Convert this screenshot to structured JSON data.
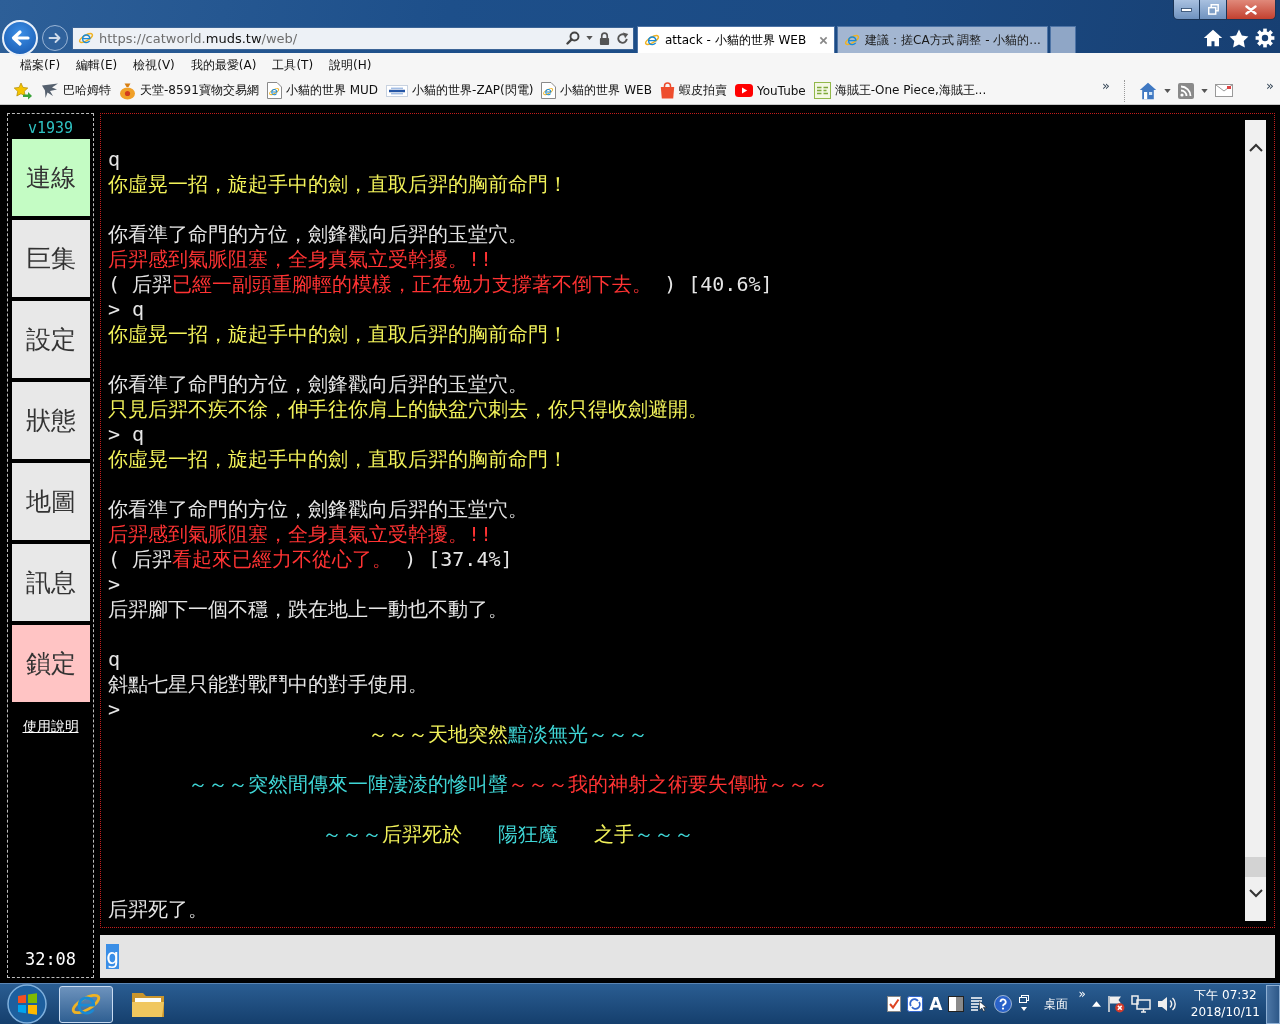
{
  "window": {
    "tabs": [
      {
        "title": "attack - 小貓的世界 WEB",
        "selected": true
      },
      {
        "title": "建議：搓CA方式 調整 - 小貓的...",
        "selected": false
      }
    ],
    "address_bar": {
      "url_parts": [
        {
          "text": "https://catworld.",
          "emphasis": false
        },
        {
          "text": "muds.tw",
          "emphasis": true
        },
        {
          "text": "/web/",
          "emphasis": false
        }
      ]
    },
    "menu_bar": {
      "items": [
        "檔案(F)",
        "編輯(E)",
        "檢視(V)",
        "我的最愛(A)",
        "工具(T)",
        "說明(H)"
      ]
    },
    "favorites_bar": {
      "items": [
        {
          "label": "巴哈姆特",
          "kind": "bird"
        },
        {
          "label": "天堂-8591寶物交易網",
          "kind": "moneybag"
        },
        {
          "label": "小貓的世界 MUD",
          "kind": "page"
        },
        {
          "label": "小貓的世界-ZAP(閃電)",
          "kind": "banner"
        },
        {
          "label": "小貓的世界 WEB",
          "kind": "page"
        },
        {
          "label": "蝦皮拍賣",
          "kind": "bag"
        },
        {
          "label": "YouTube",
          "kind": "video"
        },
        {
          "label": "海賊王-One Piece,海賊王...",
          "kind": "tile"
        }
      ],
      "overflow": "»"
    },
    "command_bar": {
      "overflow": "»"
    }
  },
  "sidebar": {
    "version": "v1939",
    "buttons": [
      {
        "label": "連線",
        "color": "#c4fcc4"
      },
      {
        "label": "巨集",
        "color": "#e8e8e8"
      },
      {
        "label": "設定",
        "color": "#e8e8e8"
      },
      {
        "label": "狀態",
        "color": "#e8e8e8"
      },
      {
        "label": "地圖",
        "color": "#e8e8e8"
      },
      {
        "label": "訊息",
        "color": "#e8e8e8"
      },
      {
        "label": "鎖定",
        "color": "#ffc4c4"
      }
    ],
    "help_link": "使用說明",
    "timer": "32:08"
  },
  "terminal": {
    "lines": [
      {
        "kind": "text",
        "segments": [
          {
            "text": "q",
            "color": "#e6e6e6"
          }
        ]
      },
      {
        "kind": "text",
        "segments": [
          {
            "text": "你虛晃一招，旋起手中的劍，直取后羿的胸前命門！",
            "color": "#f2f25a"
          }
        ]
      },
      {
        "kind": "blank"
      },
      {
        "kind": "text",
        "segments": [
          {
            "text": "你看準了命門的方位，劍鋒戳向后羿的玉堂穴。",
            "color": "#e6e6e6"
          }
        ]
      },
      {
        "kind": "text",
        "segments": [
          {
            "text": "后羿感到氣脈阻塞，全身真氣立受幹擾。!!",
            "color": "#ff3333"
          }
        ]
      },
      {
        "kind": "text",
        "segments": [
          {
            "text": "( 后羿",
            "color": "#e6e6e6"
          },
          {
            "text": "已經一副頭重腳輕的模樣，正在勉力支撐著不倒下去。",
            "color": "#ff3333"
          },
          {
            "text": " ) [40.6%]",
            "color": "#e6e6e6"
          }
        ]
      },
      {
        "kind": "text",
        "segments": [
          {
            "text": "> q",
            "color": "#e6e6e6"
          }
        ]
      },
      {
        "kind": "text",
        "segments": [
          {
            "text": "你虛晃一招，旋起手中的劍，直取后羿的胸前命門！",
            "color": "#f2f25a"
          }
        ]
      },
      {
        "kind": "blank"
      },
      {
        "kind": "text",
        "segments": [
          {
            "text": "你看準了命門的方位，劍鋒戳向后羿的玉堂穴。",
            "color": "#e6e6e6"
          }
        ]
      },
      {
        "kind": "text",
        "segments": [
          {
            "text": "只見后羿不疾不徐，伸手往你肩上的缺盆穴刺去，你只得收劍避開。",
            "color": "#f2f25a"
          }
        ]
      },
      {
        "kind": "text",
        "segments": [
          {
            "text": "> q",
            "color": "#e6e6e6"
          }
        ]
      },
      {
        "kind": "text",
        "segments": [
          {
            "text": "你虛晃一招，旋起手中的劍，直取后羿的胸前命門！",
            "color": "#f2f25a"
          }
        ]
      },
      {
        "kind": "blank"
      },
      {
        "kind": "text",
        "segments": [
          {
            "text": "你看準了命門的方位，劍鋒戳向后羿的玉堂穴。",
            "color": "#e6e6e6"
          }
        ]
      },
      {
        "kind": "text",
        "segments": [
          {
            "text": "后羿感到氣脈阻塞，全身真氣立受幹擾。!!",
            "color": "#ff3333"
          }
        ]
      },
      {
        "kind": "text",
        "segments": [
          {
            "text": "( 后羿",
            "color": "#e6e6e6"
          },
          {
            "text": "看起來已經力不從心了。",
            "color": "#ff3333"
          },
          {
            "text": " ) [37.4%]",
            "color": "#e6e6e6"
          }
        ]
      },
      {
        "kind": "text",
        "segments": [
          {
            "text": ">",
            "color": "#e6e6e6"
          }
        ]
      },
      {
        "kind": "text",
        "segments": [
          {
            "text": "后羿腳下一個不穩，跌在地上一動也不動了。",
            "color": "#e6e6e6"
          }
        ]
      },
      {
        "kind": "blank"
      },
      {
        "kind": "text",
        "segments": [
          {
            "text": "q",
            "color": "#e6e6e6"
          }
        ]
      },
      {
        "kind": "text",
        "segments": [
          {
            "text": "斜點七星只能對戰鬥中的對手使用。",
            "color": "#e6e6e6"
          }
        ]
      },
      {
        "kind": "text",
        "segments": [
          {
            "text": ">",
            "color": "#e6e6e6"
          }
        ]
      },
      {
        "kind": "centered",
        "segments": [
          {
            "text": "～～～天地突然",
            "color": "#f2f25a"
          },
          {
            "text": "黯淡無光～～～",
            "color": "#3fd6d6"
          }
        ]
      },
      {
        "kind": "blank"
      },
      {
        "kind": "centered",
        "segments": [
          {
            "text": "～～～突然間傳來一陣淒淩的慘叫聲",
            "color": "#3fd6d6"
          },
          {
            "text": "～～～我的神射之術要失傳啦～～～",
            "color": "#ff3333"
          }
        ]
      },
      {
        "kind": "blank"
      },
      {
        "kind": "centered",
        "segments": [
          {
            "text": "～～～",
            "color": "#3fd6d6"
          },
          {
            "text": "后羿死於",
            "color": "#f2f25a"
          },
          {
            "text": "   陽狂魔",
            "color": "#3fd6d6"
          },
          {
            "text": "   之手",
            "color": "#f2f25a"
          },
          {
            "text": "～～～",
            "color": "#3fd6d6"
          }
        ]
      },
      {
        "kind": "blank"
      },
      {
        "kind": "blank"
      },
      {
        "kind": "text",
        "segments": [
          {
            "text": "后羿死了。",
            "color": "#e6e6e6"
          }
        ]
      }
    ]
  },
  "command_input": {
    "value": "g",
    "text_selected": true
  },
  "taskbar": {
    "apps": [
      {
        "kind": "browser",
        "active": true
      },
      {
        "kind": "folder",
        "active": false
      }
    ],
    "input_mode": "A",
    "desktop_label": "桌面",
    "overflow": "»",
    "time": "下午 07:32",
    "date": "2018/10/11"
  }
}
